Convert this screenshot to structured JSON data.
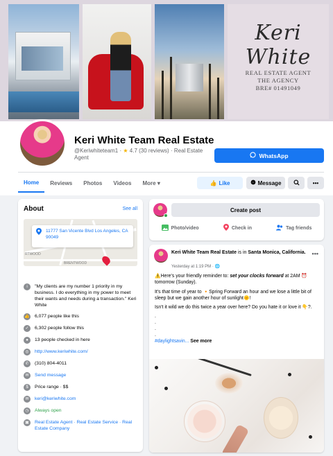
{
  "cover": {
    "signature": "Keri White",
    "tagline_lines": [
      "REAL ESTATE AGENT",
      "THE AGENCY",
      "BRE# 01491049"
    ]
  },
  "profile": {
    "name": "Keri White Team Real Estate",
    "handle": "@Keriwhiteteam1",
    "rating": "4.7",
    "reviews": "(30 reviews)",
    "category": "· Real Estate Agent",
    "whatsapp_label": "WhatsApp"
  },
  "tabs": [
    {
      "label": "Home",
      "active": true
    },
    {
      "label": "Reviews"
    },
    {
      "label": "Photos"
    },
    {
      "label": "Videos"
    },
    {
      "label": "More"
    }
  ],
  "actions": {
    "like": "Like",
    "message": "Message"
  },
  "about": {
    "title": "About",
    "see_all": "See all",
    "address": "11777 San Vicente Blvd Los Angeles, CA 90049",
    "map_labels": {
      "top_left": "RTWOOD",
      "bottom": "BRENTWOOD"
    },
    "quote": "\"My clients are my number 1 priority in my business. I do everything in my power to meet their wants and needs during a transaction.\" Keri White",
    "likes": "6,077 people like this",
    "follows": "6,302 people follow this",
    "checkins": "13 people checked in here",
    "website": "http://www.keriwhite.com/",
    "phone": "(310) 804-4011",
    "send_message": "Send message",
    "price_range": "Price range · $$",
    "email": "keri@keriwhite.com",
    "hours": "Always open",
    "categories": "Real Estate Agent · Real Estate Service · Real Estate Company"
  },
  "composer": {
    "create_post": "Create post",
    "photo_video": "Photo/video",
    "check_in": "Check in",
    "tag_friends": "Tag friends"
  },
  "post": {
    "author": "Keri White Team Real Estate",
    "location_prefix": "is in",
    "location": "Santa Monica, California.",
    "time": "Yesterday at 1:19 PM · ",
    "line1_pre": "⚠️Here's your friendly reminder to: ",
    "line1_em": "set your clocks forward",
    "line1_post": " at 2AM ⏰ tomorrow (Sunday).",
    "line2": "It's that time of year to 🔸Spring Forward an hour and we lose a little bit of sleep but we gain another hour of sunlight🌞!",
    "line3": "Isn't it wild we do this twice a year over here? Do you hate it or love it 👇?.",
    "dots": [
      ".",
      ".",
      ".",
      "."
    ],
    "hashtag": "#daylightsavin...",
    "see_more": "See more"
  },
  "colors": {
    "brand_blue": "#1877f2",
    "green": "#31a24c",
    "page_bg": "#f0f2f5",
    "pin_red": "#e41e3f"
  }
}
